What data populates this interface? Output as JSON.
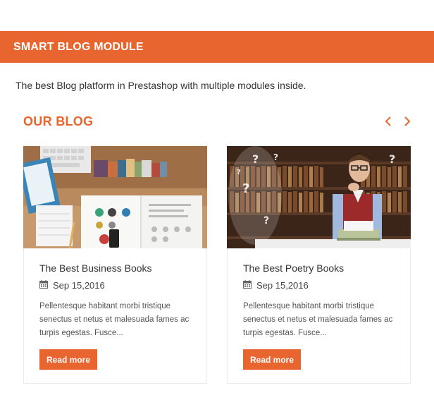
{
  "banner": {
    "title": "SMART BLOG MODULE"
  },
  "description": "The best Blog platform in Prestashop with multiple modules inside.",
  "blog": {
    "heading": "OUR BLOG",
    "nav": {
      "prev_icon": "chevron-left-icon",
      "next_icon": "chevron-right-icon"
    },
    "posts": [
      {
        "title": "The Best Business Books",
        "date": "Sep 15,2016",
        "excerpt": "Pellentesque habitant morbi tristique senectus et netus et malesuada fames ac turpis egestas. Fusce...",
        "button": "Read more",
        "date_icon": "calendar-icon"
      },
      {
        "title": "The Best Poetry Books",
        "date": "Sep 15,2016",
        "excerpt": "Pellentesque habitant morbi tristique senectus et netus et malesuada fames ac turpis egestas. Fusce...",
        "button": "Read more",
        "date_icon": "calendar-icon"
      }
    ]
  },
  "colors": {
    "accent": "#e8652f",
    "text": "#333333"
  }
}
